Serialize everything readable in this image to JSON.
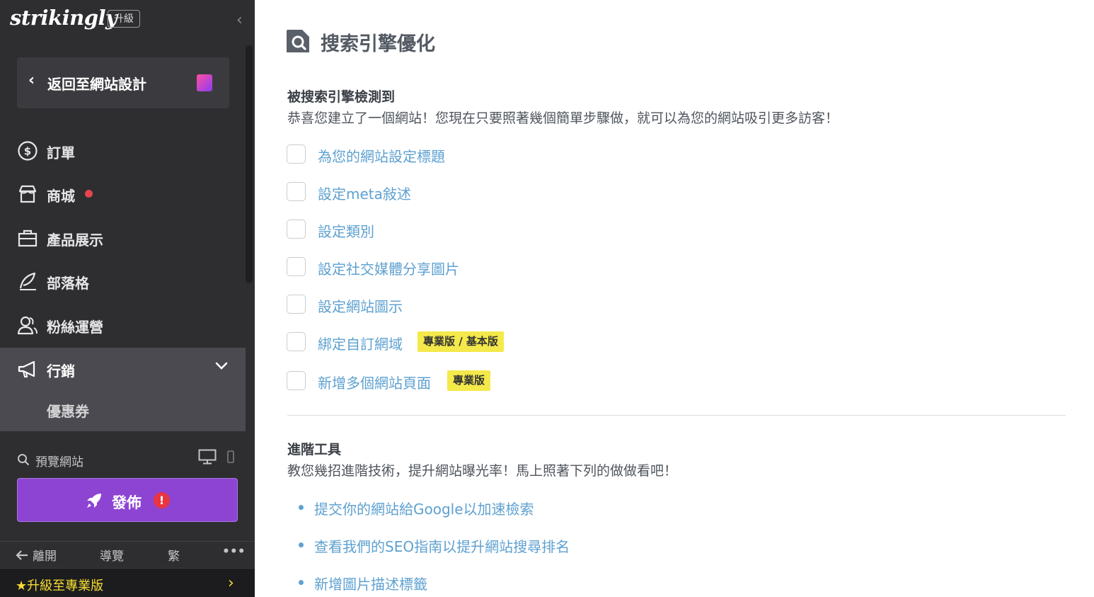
{
  "sidebar": {
    "brand": "strikingly",
    "upgrade_badge": "升級",
    "back_label": "返回至網站設計",
    "nav": {
      "orders": "訂單",
      "store": "商城",
      "showcase": "產品展示",
      "blog": "部落格",
      "fans": "粉絲運營",
      "marketing": "行銷",
      "coupons": "優惠券"
    },
    "preview_label": "預覽網站",
    "publish_label": "發佈",
    "publish_alert": "!",
    "bottom": {
      "leave": "離開",
      "guide": "導覽",
      "lang": "繁",
      "more": "•••"
    },
    "upgrade_pro": "★升級至專業版"
  },
  "main": {
    "title": "搜索引擎優化",
    "detected": {
      "title": "被搜索引擎檢測到",
      "desc": "恭喜您建立了一個網站！您現在只要照著幾個簡單步驟做，就可以為您的網站吸引更多訪客！",
      "items": [
        {
          "label": "為您的網站設定標題"
        },
        {
          "label": "設定meta敍述"
        },
        {
          "label": "設定類別"
        },
        {
          "label": "設定社交媒體分享圖片"
        },
        {
          "label": "設定網站圖示"
        },
        {
          "label": "綁定自訂網域",
          "tag": "專業版 / 基本版"
        },
        {
          "label": "新增多個網站頁面",
          "tag": "專業版"
        }
      ]
    },
    "advanced": {
      "title": "進階工具",
      "desc": "教您幾招進階技術，提升網站曝光率！馬上照著下列的做做看吧！",
      "links": [
        "提交你的網站給Google以加速檢索",
        "查看我們的SEO指南以提升網站搜尋排名",
        "新增圖片描述標籤"
      ]
    }
  },
  "colors": {
    "sidebar_bg": "#2e2e31",
    "active_bg": "#4a4a50",
    "publish_purple": "#8e44d2",
    "link_blue": "#5ea1d0",
    "tag_yellow": "#f4e94a",
    "upgrade_yellow": "#f5dd33",
    "alert_red": "#e8353f"
  },
  "icons": {
    "collapse": "chevron-left-icon",
    "orders": "dollar-circle-icon",
    "store": "store-icon",
    "showcase": "briefcase-icon",
    "blog": "feather-icon",
    "fans": "users-icon",
    "marketing": "megaphone-icon",
    "publish": "rocket-icon",
    "page": "seo-search-icon"
  }
}
